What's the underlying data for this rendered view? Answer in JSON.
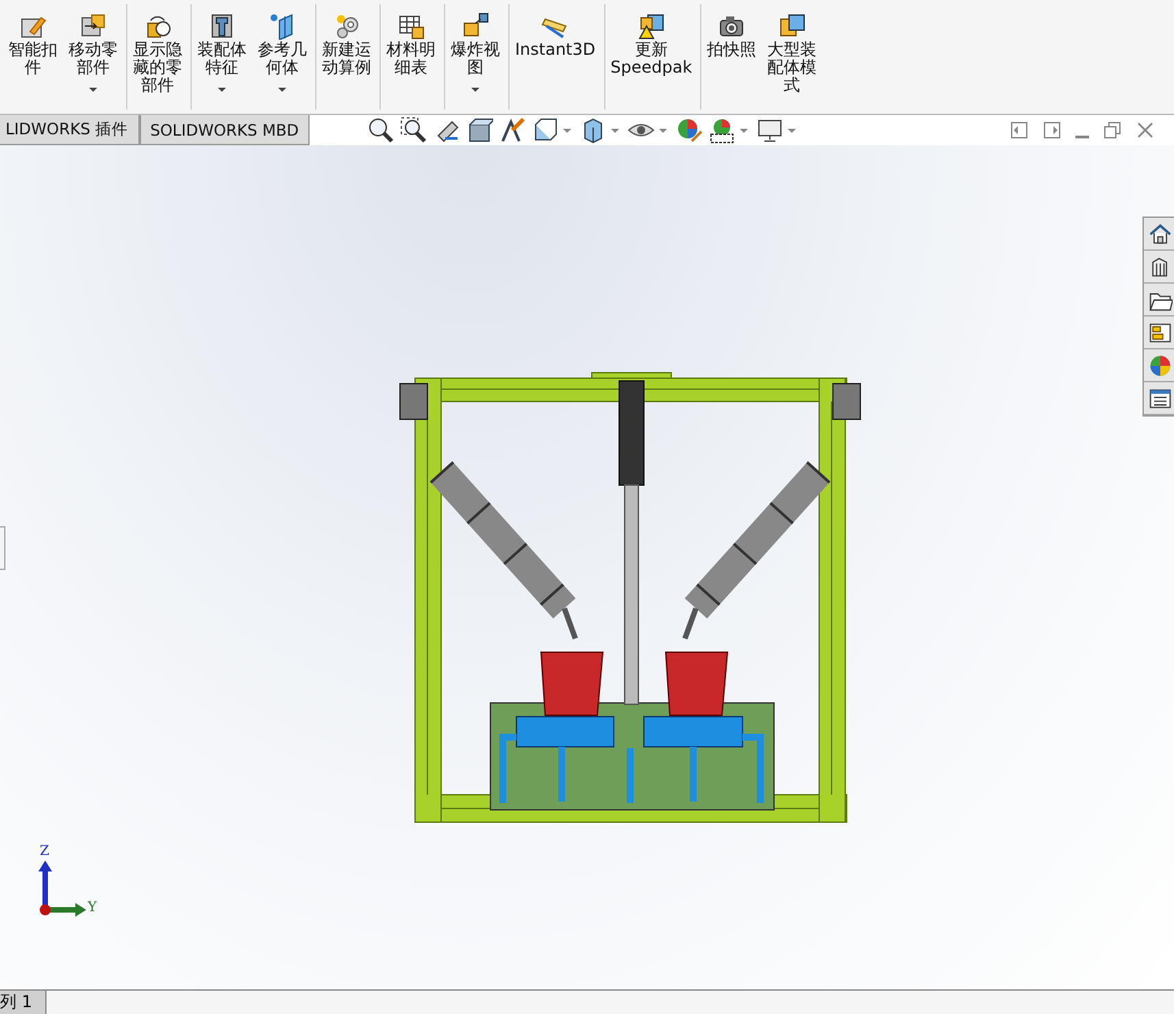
{
  "toolbar": {
    "buttons": [
      {
        "label": "智能扣件",
        "dropdown": false,
        "separator_after": false
      },
      {
        "label": "移动零部件",
        "dropdown": true,
        "separator_after": true
      },
      {
        "label": "显示隐藏的零部件",
        "dropdown": false,
        "separator_after": true
      },
      {
        "label": "装配体特征",
        "dropdown": true,
        "separator_after": false
      },
      {
        "label": "参考几何体",
        "dropdown": true,
        "separator_after": true
      },
      {
        "label": "新建运动算例",
        "dropdown": false,
        "separator_after": true
      },
      {
        "label": "材料明细表",
        "dropdown": false,
        "separator_after": true
      },
      {
        "label": "爆炸视图",
        "dropdown": true,
        "separator_after": true
      },
      {
        "label": "Instant3D",
        "dropdown": false,
        "separator_after": true
      },
      {
        "label": "更新 Speedpak",
        "dropdown": false,
        "separator_after": true
      },
      {
        "label": "拍快照",
        "dropdown": false,
        "separator_after": false
      },
      {
        "label": "大型装配体模式",
        "dropdown": false,
        "separator_after": false
      }
    ]
  },
  "command_tabs": [
    {
      "label": "LIDWORKS 插件",
      "selected": false
    },
    {
      "label": "SOLIDWORKS MBD",
      "selected": false
    }
  ],
  "viewport": {
    "triad": {
      "z_label": "Z",
      "y_label": "Y"
    }
  },
  "bottom_tabs": [
    {
      "label": "列 1",
      "selected": true
    }
  ]
}
